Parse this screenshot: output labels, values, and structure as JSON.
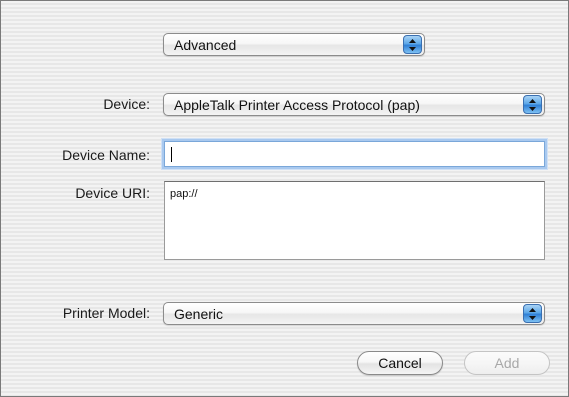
{
  "mode_popup": {
    "value": "Advanced"
  },
  "device": {
    "label": "Device:",
    "value": "AppleTalk Printer Access Protocol (pap)"
  },
  "device_name": {
    "label": "Device Name:",
    "value": ""
  },
  "device_uri": {
    "label": "Device URI:",
    "value": "pap://"
  },
  "printer_model": {
    "label": "Printer Model:",
    "value": "Generic"
  },
  "buttons": {
    "cancel": "Cancel",
    "add": "Add"
  },
  "icons": {
    "popup_arrows": "up-down-arrows-icon"
  },
  "colors": {
    "accent": "#3f87d8",
    "focus_ring": "#a9c9ef",
    "disabled_text": "#a8a8a8"
  }
}
